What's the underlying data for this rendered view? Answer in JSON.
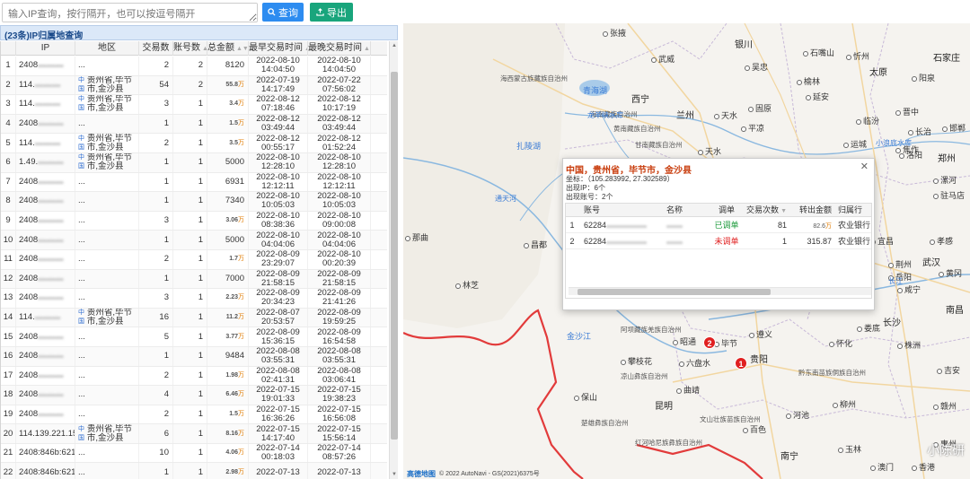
{
  "toolbar": {
    "search_placeholder": "输入IP查询，按行隔开，也可以按逗号隔开",
    "query_label": "查询",
    "export_label": "导出"
  },
  "panel": {
    "title": "(23条)IP归属地查询"
  },
  "columns": [
    "IP",
    "地区",
    "交易数",
    "账号数",
    "总金额",
    "最早交易时间",
    "最晚交易时间"
  ],
  "rows": [
    {
      "no": "1",
      "ip": "2408",
      "area": "...",
      "cnt": "2",
      "acc": "2",
      "amt": "8120",
      "t1a": "2022-08-10",
      "t1b": "14:04:50",
      "t2a": "2022-08-10",
      "t2b": "14:04:50"
    },
    {
      "no": "2",
      "ip": "114.",
      "area": "贵州省,毕节市,金沙县",
      "cnt": "54",
      "acc": "2",
      "amt": "55.8",
      "amt_unit": "万",
      "t1a": "2022-07-19",
      "t1b": "14:17:49",
      "t2a": "2022-07-22",
      "t2b": "07:56:02"
    },
    {
      "no": "3",
      "ip": "114.",
      "area": "贵州省,毕节市,金沙县",
      "cnt": "3",
      "acc": "1",
      "amt": "3.4",
      "amt_unit": "万",
      "t1a": "2022-08-12",
      "t1b": "07:18:46",
      "t2a": "2022-08-12",
      "t2b": "10:17:19"
    },
    {
      "no": "4",
      "ip": "2408",
      "area": "...",
      "cnt": "1",
      "acc": "1",
      "amt": "1.5",
      "amt_unit": "万",
      "t1a": "2022-08-12",
      "t1b": "03:49:44",
      "t2a": "2022-08-12",
      "t2b": "03:49:44"
    },
    {
      "no": "5",
      "ip": "114.",
      "area": "贵州省,毕节市,金沙县",
      "cnt": "2",
      "acc": "1",
      "amt": "3.5",
      "amt_unit": "万",
      "t1a": "2022-08-12",
      "t1b": "00:55:17",
      "t2a": "2022-08-12",
      "t2b": "01:52:24"
    },
    {
      "no": "6",
      "ip": "1.49.",
      "area": "贵州省,毕节市,金沙县",
      "cnt": "1",
      "acc": "1",
      "amt": "5000",
      "t1a": "2022-08-10",
      "t1b": "12:28:10",
      "t2a": "2022-08-10",
      "t2b": "12:28:10"
    },
    {
      "no": "7",
      "ip": "2408",
      "area": "...",
      "cnt": "1",
      "acc": "1",
      "amt": "6931",
      "t1a": "2022-08-10",
      "t1b": "12:12:11",
      "t2a": "2022-08-10",
      "t2b": "12:12:11"
    },
    {
      "no": "8",
      "ip": "2408",
      "area": "...",
      "cnt": "1",
      "acc": "1",
      "amt": "7340",
      "t1a": "2022-08-10",
      "t1b": "10:05:03",
      "t2a": "2022-08-10",
      "t2b": "10:05:03"
    },
    {
      "no": "9",
      "ip": "2408",
      "area": "...",
      "cnt": "3",
      "acc": "1",
      "amt": "3.06",
      "amt_unit": "万",
      "t1a": "2022-08-10",
      "t1b": "08:38:36",
      "t2a": "2022-08-10",
      "t2b": "09:00:08"
    },
    {
      "no": "10",
      "ip": "2408",
      "area": "...",
      "cnt": "1",
      "acc": "1",
      "amt": "5000",
      "t1a": "2022-08-10",
      "t1b": "04:04:06",
      "t2a": "2022-08-10",
      "t2b": "04:04:06"
    },
    {
      "no": "11",
      "ip": "2408",
      "area": "...",
      "cnt": "2",
      "acc": "1",
      "amt": "1.7",
      "amt_unit": "万",
      "t1a": "2022-08-09",
      "t1b": "23:29:07",
      "t2a": "2022-08-10",
      "t2b": "00:20:39"
    },
    {
      "no": "12",
      "ip": "2408",
      "area": "...",
      "cnt": "1",
      "acc": "1",
      "amt": "7000",
      "t1a": "2022-08-09",
      "t1b": "21:58:15",
      "t2a": "2022-08-09",
      "t2b": "21:58:15"
    },
    {
      "no": "13",
      "ip": "2408",
      "area": "...",
      "cnt": "3",
      "acc": "1",
      "amt": "2.23",
      "amt_unit": "万",
      "t1a": "2022-08-09",
      "t1b": "20:34:23",
      "t2a": "2022-08-09",
      "t2b": "21:41:26"
    },
    {
      "no": "14",
      "ip": "114.",
      "area": "贵州省,毕节市,金沙县",
      "cnt": "16",
      "acc": "1",
      "amt": "11.2",
      "amt_unit": "万",
      "t1a": "2022-08-07",
      "t1b": "20:53:57",
      "t2a": "2022-08-09",
      "t2b": "19:59:25"
    },
    {
      "no": "15",
      "ip": "2408",
      "area": "...",
      "cnt": "5",
      "acc": "1",
      "amt": "3.77",
      "amt_unit": "万",
      "t1a": "2022-08-09",
      "t1b": "15:36:15",
      "t2a": "2022-08-09",
      "t2b": "16:54:58"
    },
    {
      "no": "16",
      "ip": "2408",
      "area": "...",
      "cnt": "1",
      "acc": "1",
      "amt": "9484",
      "t1a": "2022-08-08",
      "t1b": "03:55:31",
      "t2a": "2022-08-08",
      "t2b": "03:55:31"
    },
    {
      "no": "17",
      "ip": "2408",
      "area": "...",
      "cnt": "2",
      "acc": "1",
      "amt": "1.98",
      "amt_unit": "万",
      "t1a": "2022-08-08",
      "t1b": "02:41:31",
      "t2a": "2022-08-08",
      "t2b": "03:06:41"
    },
    {
      "no": "18",
      "ip": "2408",
      "area": "...",
      "cnt": "4",
      "acc": "1",
      "amt": "6.46",
      "amt_unit": "万",
      "t1a": "2022-07-15",
      "t1b": "19:01:33",
      "t2a": "2022-07-15",
      "t2b": "19:38:23"
    },
    {
      "no": "19",
      "ip": "2408",
      "area": "...",
      "cnt": "2",
      "acc": "1",
      "amt": "1.5",
      "amt_unit": "万",
      "t1a": "2022-07-15",
      "t1b": "16:36:26",
      "t2a": "2022-07-15",
      "t2b": "16:56:08"
    },
    {
      "no": "20",
      "ip": "114.139.221.156",
      "area": "贵州省,毕节市,金沙县",
      "cnt": "6",
      "acc": "1",
      "amt": "8.16",
      "amt_unit": "万",
      "t1a": "2022-07-15",
      "t1b": "14:17:40",
      "t2a": "2022-07-15",
      "t2b": "15:56:14"
    },
    {
      "no": "21",
      "ip": "2408:846b:6210:5",
      "area": "...",
      "cnt": "10",
      "acc": "1",
      "amt": "4.06",
      "amt_unit": "万",
      "t1a": "2022-07-14",
      "t1b": "00:18:03",
      "t2a": "2022-07-14",
      "t2b": "08:57:26"
    },
    {
      "no": "22",
      "ip": "2408:846b:6211",
      "area": "...",
      "cnt": "1",
      "acc": "1",
      "amt": "2.98",
      "amt_unit": "万",
      "t1a": "2022-07-13",
      "t1b": "",
      "t2a": "2022-07-13",
      "t2b": ""
    }
  ],
  "isp_tag": "中国",
  "popup": {
    "title": "中国，贵州省，毕节市，金沙县",
    "coord": "坐标：（105.283992, 27.302589）",
    "ip_count": "出现IP：6个",
    "acc_count": "出现账号：2个",
    "columns": [
      "账号",
      "名称",
      "调单",
      "交易次数",
      "转出金额",
      "归属行"
    ],
    "rows": [
      {
        "no": "1",
        "card": "62284",
        "flag": "已调单",
        "flag_type": "ok",
        "cnt": "81",
        "amt": "82.6",
        "amt_unit": "万",
        "bank": "农业银行"
      },
      {
        "no": "2",
        "card": "62284",
        "flag": "未调单",
        "flag_type": "no",
        "cnt": "1",
        "amt": "315.87",
        "amt_unit": "",
        "bank": "农业银行"
      }
    ]
  },
  "map": {
    "markers": [
      "1",
      "2"
    ],
    "footer_logo": "高德地图",
    "footer_text": "© 2022 AutoNavi - GS(2021)6375号",
    "watermark": "小陈研",
    "cities": [
      "张掖",
      "银川",
      "石嘴山",
      "太原",
      "石家庄",
      "武威",
      "吴忠",
      "榆林",
      "忻州",
      "阳泉",
      "海西蒙古族藏族自治州",
      "青海湖",
      "西宁",
      "延安",
      "晋中",
      "兰州",
      "固原",
      "临汾",
      "长治",
      "邯郸",
      "海南藏族自治州",
      "黄南藏族自治州",
      "天水",
      "平凉",
      "运城",
      "焦作",
      "郑州",
      "扎陵湖",
      "甘南藏族自治州",
      "天水",
      "洛阳",
      "漯河",
      "驻马店",
      "咸宁",
      "武汉",
      "南昌",
      "那曲",
      "昌都",
      "林芝",
      "金沙江",
      "昭通",
      "遵义",
      "贵阳",
      "六盘水",
      "毕节",
      "攀枝花",
      "曲靖",
      "昆明",
      "保山",
      "河池",
      "百色",
      "南宁",
      "柳州",
      "玉林",
      "惠州",
      "香港",
      "澳门",
      "怀化",
      "株洲",
      "吉安",
      "赣州",
      "娄底",
      "岳阳",
      "长沙",
      "宜昌",
      "荆州",
      "孝感",
      "黄冈"
    ],
    "regions": [
      "果洛藏族自治州",
      "阿坝藏族羌族自治州",
      "甘孜藏族自治州",
      "凉山彝族自治州",
      "红河哈尼族彝族自治州",
      "楚雄彝族自治州",
      "文山壮族苗族自治州",
      "大理白族自治州",
      "黔东南苗族侗族自治州",
      "黔南布依族苗族自治州",
      "黔西南布依族苗族自治州",
      "恩施土家族苗族自治州",
      "湘西土家族苗族自治州",
      "玉树藏族自治州",
      "柴达木"
    ],
    "rivers": [
      "龙羊峡水库",
      "金沙江",
      "通天河",
      "小浪底水库",
      "长江"
    ]
  }
}
